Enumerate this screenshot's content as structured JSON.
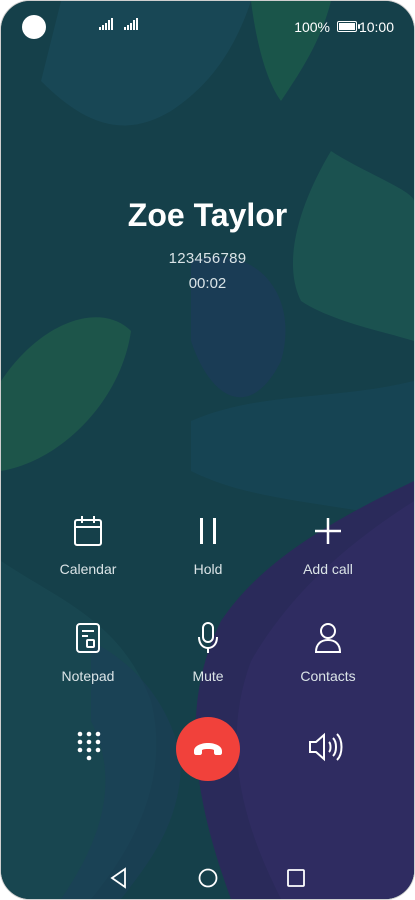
{
  "status_bar": {
    "battery_percent": "100%",
    "time": "10:00"
  },
  "call": {
    "contact_name": "Zoe Taylor",
    "number": "123456789",
    "duration": "00:02"
  },
  "actions_row1": [
    {
      "label": "Calendar",
      "icon": "calendar-icon"
    },
    {
      "label": "Hold",
      "icon": "pause-icon"
    },
    {
      "label": "Add call",
      "icon": "plus-icon"
    }
  ],
  "actions_row2": [
    {
      "label": "Notepad",
      "icon": "notepad-icon"
    },
    {
      "label": "Mute",
      "icon": "microphone-icon"
    },
    {
      "label": "Contacts",
      "icon": "person-icon"
    }
  ],
  "colors": {
    "background": "#14414a",
    "end_call": "#f1413b",
    "text": "#ffffff"
  }
}
